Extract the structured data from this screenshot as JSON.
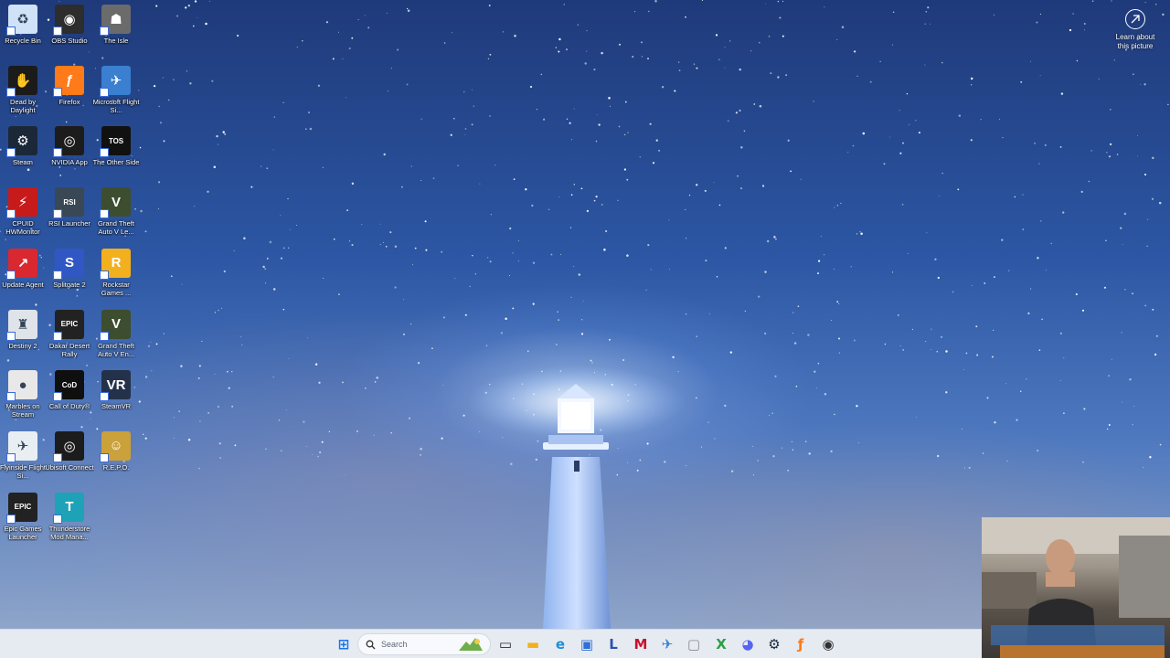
{
  "desktop": {
    "icons": [
      {
        "label": "Recycle Bin",
        "icon": "recycle-bin-icon"
      },
      {
        "label": "OBS Studio",
        "icon": "obs-icon"
      },
      {
        "label": "The Isle",
        "icon": "the-isle-icon"
      },
      {
        "label": "Dead by Daylight",
        "icon": "dead-by-daylight-icon"
      },
      {
        "label": "Firefox",
        "icon": "firefox-icon"
      },
      {
        "label": "Microsoft Flight Si...",
        "icon": "flight-simulator-icon"
      },
      {
        "label": "Steam",
        "icon": "steam-icon"
      },
      {
        "label": "NVIDIA App",
        "icon": "nvidia-icon"
      },
      {
        "label": "The Other Side",
        "icon": "tos-icon"
      },
      {
        "label": "CPUID HWMonitor",
        "icon": "hwmonitor-icon"
      },
      {
        "label": "RSI Launcher",
        "icon": "rsi-icon"
      },
      {
        "label": "Grand Theft Auto V Le...",
        "icon": "gta-v-icon"
      },
      {
        "label": "Update Agent",
        "icon": "update-agent-icon"
      },
      {
        "label": "Splitgate 2",
        "icon": "splitgate-icon"
      },
      {
        "label": "Rockstar Games ...",
        "icon": "rockstar-icon"
      },
      {
        "label": "Destiny 2",
        "icon": "destiny-icon"
      },
      {
        "label": "Dakar Desert Rally",
        "icon": "epic-games-icon"
      },
      {
        "label": "Grand Theft Auto V En...",
        "icon": "gta-v-icon"
      },
      {
        "label": "Marbles on Stream",
        "icon": "marbles-icon"
      },
      {
        "label": "Call of Duty®",
        "icon": "call-of-duty-icon"
      },
      {
        "label": "SteamVR",
        "icon": "steamvr-icon"
      },
      {
        "label": "Flyinside Flight Si...",
        "icon": "flyinside-icon"
      },
      {
        "label": "Ubisoft Connect",
        "icon": "ubisoft-icon"
      },
      {
        "label": "R.E.P.O.",
        "icon": "repo-icon"
      },
      {
        "label": "Epic Games Launcher",
        "icon": "epic-games-icon"
      },
      {
        "label": "Thunderstore Mod Mana...",
        "icon": "thunderstore-icon"
      }
    ],
    "learn_about": "Learn about this picture"
  },
  "taskbar": {
    "search_placeholder": "Search",
    "pinned": [
      {
        "icon": "start-icon",
        "color": "#1a73e8"
      },
      {
        "icon": "task-view-icon",
        "color": "#2b2b2b"
      },
      {
        "icon": "file-explorer-icon",
        "color": "#f2b01e"
      },
      {
        "icon": "edge-icon",
        "color": "#1d8fd6"
      },
      {
        "icon": "store-icon",
        "color": "#2f6fd6"
      },
      {
        "icon": "lexicon-icon",
        "color": "#2b4fb5"
      },
      {
        "icon": "mcafee-icon",
        "color": "#c8102e"
      },
      {
        "icon": "flight-simulator-icon",
        "color": "#3a7fd0"
      },
      {
        "icon": "app-icon",
        "color": "#8a8a8a"
      },
      {
        "icon": "xbox-icon",
        "color": "#2f9e44"
      },
      {
        "icon": "discord-icon",
        "color": "#5865f2"
      },
      {
        "icon": "steam-icon",
        "color": "#1b2838"
      },
      {
        "icon": "firefox-icon",
        "color": "#ff7a18"
      },
      {
        "icon": "obs-icon",
        "color": "#303030"
      }
    ]
  }
}
